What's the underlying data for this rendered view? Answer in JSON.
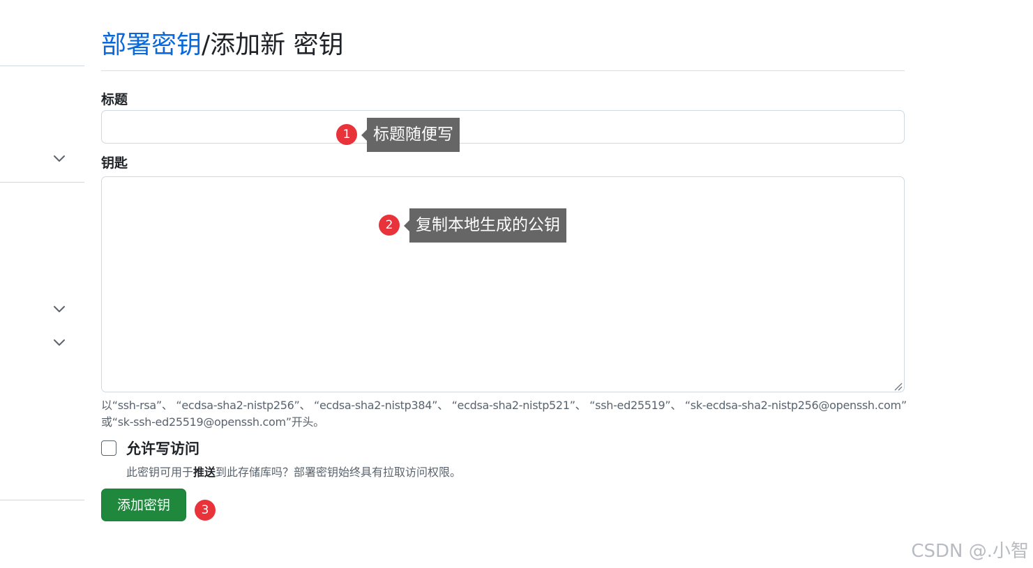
{
  "breadcrumb": {
    "link_label": "部署密钥",
    "separator": "/",
    "current": "添加新 密钥"
  },
  "form": {
    "title_label": "标题",
    "title_value": "",
    "key_label": "钥匙",
    "key_value": "",
    "key_hint_line1": "以“ssh-rsa”、 “ecdsa-sha2-nistp256”、 “ecdsa-sha2-nistp384”、 “ecdsa-sha2-nistp521”、 “ssh-ed25519”、 “sk-ecdsa-sha2-nistp256@openssh.com”",
    "key_hint_line2": "或“sk-ssh-ed25519@openssh.com”开头。",
    "write_access_label": "允许写访问",
    "write_access_checked": false,
    "write_note_before": "此密钥可用于",
    "write_note_bold": "推送",
    "write_note_after": "到此存储库吗？部署密钥始终具有拉取访问权限。",
    "submit_label": "添加密钥"
  },
  "annotations": [
    {
      "number": "1",
      "text": "标题随便写"
    },
    {
      "number": "2",
      "text": "复制本地生成的公钥"
    },
    {
      "number": "3"
    }
  ],
  "watermark": "CSDN @.小智",
  "colors": {
    "link": "#0969da",
    "primary_button": "#1f883d",
    "badge": "#e8333a",
    "callout": "#666666"
  },
  "icons": [
    "chevron-down-icon",
    "resize-grip-icon"
  ]
}
